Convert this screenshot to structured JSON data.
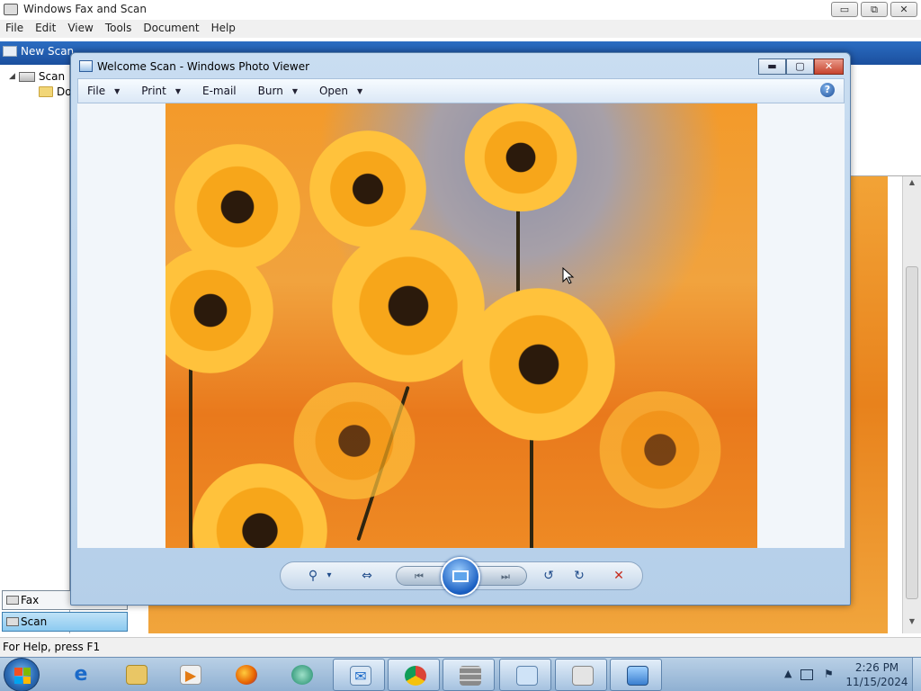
{
  "bg_app": {
    "title": "Windows Fax and Scan",
    "winbtns": {
      "minimize": "▭",
      "restore": "⧉",
      "close": "✕"
    },
    "menu": [
      "File",
      "Edit",
      "View",
      "Tools",
      "Document",
      "Help"
    ],
    "toolbar": {
      "new_scan": "New Scan"
    },
    "tree": {
      "scan": "Scan",
      "docs": "Do"
    },
    "nav": {
      "fax": "Fax",
      "scan": "Scan"
    },
    "status": "For Help, press F1"
  },
  "viewer": {
    "title": "Welcome Scan - Windows Photo Viewer",
    "winbtns": {
      "minimize": "▬",
      "restore": "▢",
      "close": "✕"
    },
    "menu": {
      "file": "File",
      "print": "Print",
      "email": "E-mail",
      "burn": "Burn",
      "open": "Open"
    },
    "help": "?",
    "controls": {
      "zoom": "⚲",
      "zoom_caret": "▾",
      "fit": "⇔",
      "prev": "⏮",
      "next": "⏭",
      "rotate_ccw": "↺",
      "rotate_cw": "↻",
      "delete": "✕"
    }
  },
  "taskbar": {
    "clock_time": "2:26 PM",
    "clock_date": "11/15/2024",
    "tray_arrow": "▲",
    "icons": [
      "ie-icon",
      "explorer-icon",
      "media-player-icon",
      "firefox-icon",
      "teamviewer-icon",
      "fax-scan-icon",
      "chrome-icon",
      "firewall-icon",
      "control-panel-icon",
      "printer-icon",
      "photo-viewer-icon"
    ]
  },
  "colors": {
    "accent": "#1f4b8a",
    "delete": "#c62c1d",
    "photo_orange": "#f39a2a"
  }
}
